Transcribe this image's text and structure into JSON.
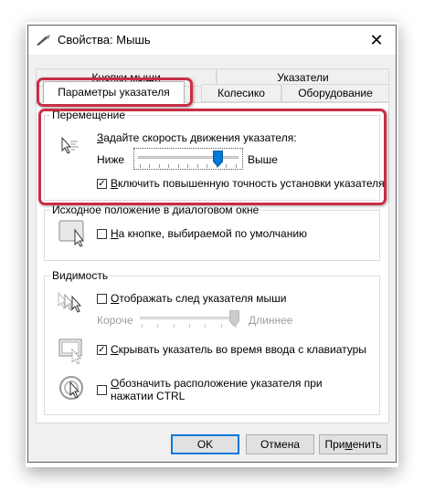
{
  "window": {
    "title": "Свойства: Мышь",
    "icons": {
      "app": "mouse-pointer-icon",
      "close": "close-icon"
    }
  },
  "tabs": {
    "back_row": [
      "Кнопки мыши",
      "Указатели"
    ],
    "front_row": [
      "Параметры указателя",
      "Колесико",
      "Оборудование"
    ],
    "active": "Параметры указателя"
  },
  "motion": {
    "title": "Перемещение",
    "speed_label": "Задайте скорость движения указателя:",
    "slow_label": "Ниже",
    "fast_label": "Выше",
    "speed_value_fraction": 0.8,
    "precision_label": "Включить повышенную точность установки указателя",
    "precision_checked": true,
    "icon": "pointer-speed-icon"
  },
  "snap": {
    "title": "Исходное положение в диалоговом окне",
    "label": "На кнопке, выбираемой по умолчанию",
    "checked": false,
    "icon": "snap-to-button-icon"
  },
  "visibility": {
    "title": "Видимость",
    "trails_label": "Отображать след указателя мыши",
    "trails_checked": false,
    "trails_short": "Короче",
    "trails_long": "Длиннее",
    "trails_value_fraction": 1.0,
    "hide_label": "Скрывать указатель во время ввода с клавиатуры",
    "hide_checked": true,
    "ctrl_label": "Обозначить расположение указателя при нажатии CTRL",
    "ctrl_checked": false,
    "icons": {
      "trails": "pointer-trails-icon",
      "hide": "hide-pointer-icon",
      "ctrl": "locate-pointer-icon"
    }
  },
  "buttons": {
    "ok": "OK",
    "cancel": "Отмена",
    "apply": "Применить"
  },
  "highlight_color": "#c92e44",
  "accent_color": "#0078d7"
}
